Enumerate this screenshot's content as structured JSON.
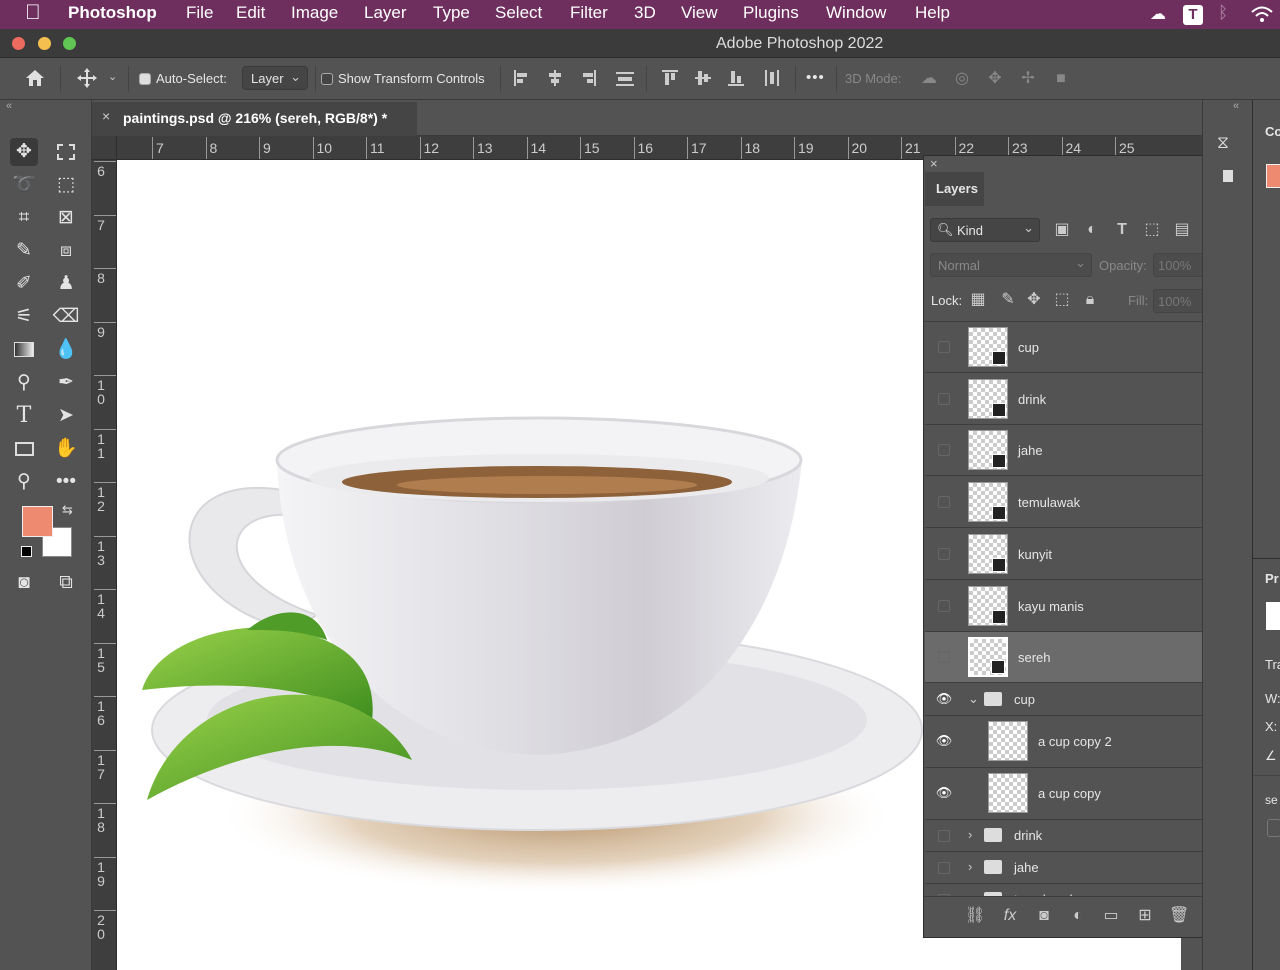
{
  "menubar": {
    "app_name": "Photoshop",
    "items": [
      "File",
      "Edit",
      "Image",
      "Layer",
      "Type",
      "Select",
      "Filter",
      "3D",
      "View",
      "Plugins",
      "Window",
      "Help"
    ]
  },
  "window": {
    "title": "Adobe Photoshop 2022"
  },
  "options_bar": {
    "auto_select_label": "Auto-Select:",
    "auto_select_checked": true,
    "layer_select_value": "Layer",
    "show_transform_label": "Show Transform Controls",
    "show_transform_checked": false,
    "more_label": "•••",
    "mode_3d_label": "3D Mode:"
  },
  "document": {
    "tab_title": "paintings.psd @ 216% (sereh, RGB/8*) *",
    "close_glyph": "×"
  },
  "rulers": {
    "horizontal": [
      "7",
      "8",
      "9",
      "10",
      "11",
      "12",
      "13",
      "14",
      "15",
      "16",
      "17",
      "18",
      "19",
      "20",
      "21",
      "22",
      "23",
      "24",
      "25"
    ],
    "vertical": [
      [
        "6"
      ],
      [
        "7"
      ],
      [
        "8"
      ],
      [
        "9"
      ],
      [
        "1",
        "0"
      ],
      [
        "1",
        "1"
      ],
      [
        "1",
        "2"
      ],
      [
        "1",
        "3"
      ],
      [
        "1",
        "4"
      ],
      [
        "1",
        "5"
      ],
      [
        "1",
        "6"
      ],
      [
        "1",
        "7"
      ],
      [
        "1",
        "8"
      ],
      [
        "1",
        "9"
      ],
      [
        "2",
        "0"
      ]
    ]
  },
  "colors": {
    "foreground": "#ee8a6f",
    "background": "#ffffff",
    "menubar": "#6e2f5e"
  },
  "layers_panel": {
    "title": "Layers",
    "filter_kind": "Kind",
    "blend_mode": "Normal",
    "opacity_label": "Opacity:",
    "opacity_value": "100%",
    "lock_label": "Lock:",
    "fill_label": "Fill:",
    "fill_value": "100%",
    "layers": [
      {
        "name": "cup",
        "visible": false,
        "type": "smart",
        "selected": false
      },
      {
        "name": "drink",
        "visible": false,
        "type": "smart",
        "selected": false
      },
      {
        "name": "jahe",
        "visible": false,
        "type": "smart",
        "selected": false
      },
      {
        "name": "temulawak",
        "visible": false,
        "type": "smart",
        "selected": false
      },
      {
        "name": "kunyit",
        "visible": false,
        "type": "smart",
        "selected": false
      },
      {
        "name": "kayu manis",
        "visible": false,
        "type": "smart",
        "selected": false
      },
      {
        "name": "sereh",
        "visible": false,
        "type": "smart",
        "selected": true
      }
    ],
    "group_cup": {
      "name": "cup",
      "visible": true,
      "expanded": true,
      "children": [
        {
          "name": "a cup copy 2",
          "visible": true
        },
        {
          "name": "a cup copy",
          "visible": true
        }
      ]
    },
    "groups_collapsed": [
      {
        "name": "drink",
        "visible": false
      },
      {
        "name": "jahe",
        "visible": false
      },
      {
        "name": "temulawak",
        "visible": false
      }
    ]
  },
  "right_panel": {
    "color_tab": "Co",
    "properties_tab": "Pr",
    "transform_label": "Tra",
    "w_label": "W:",
    "x_label": "X:",
    "se_label": "se"
  }
}
